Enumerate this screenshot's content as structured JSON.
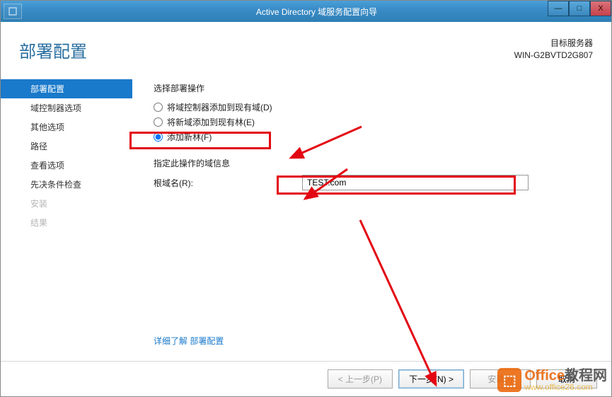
{
  "titlebar": {
    "title": "Active Directory 域服务配置向导",
    "min": "—",
    "max": "□",
    "close": "X"
  },
  "header": {
    "page_title": "部署配置",
    "target_label": "目标服务器",
    "target_value": "WIN-G2BVTD2G807"
  },
  "sidebar": {
    "items": [
      {
        "label": "部署配置",
        "state": "active"
      },
      {
        "label": "域控制器选项",
        "state": "normal"
      },
      {
        "label": "其他选项",
        "state": "normal"
      },
      {
        "label": "路径",
        "state": "normal"
      },
      {
        "label": "查看选项",
        "state": "normal"
      },
      {
        "label": "先决条件检查",
        "state": "normal"
      },
      {
        "label": "安装",
        "state": "disabled"
      },
      {
        "label": "结果",
        "state": "disabled"
      }
    ]
  },
  "panel": {
    "select_operation_label": "选择部署操作",
    "radios": [
      {
        "label": "将域控制器添加到现有域(D)",
        "checked": false
      },
      {
        "label": "将新域添加到现有林(E)",
        "checked": false
      },
      {
        "label": "添加新林(F)",
        "checked": true
      }
    ],
    "domain_info_label": "指定此操作的域信息",
    "root_domain_label": "根域名(R):",
    "root_domain_value": "TEST.com",
    "learn_more": "详细了解 部署配置"
  },
  "footer": {
    "prev": "< 上一步(P)",
    "next": "下一步(N) >",
    "install": "安装(I)",
    "cancel": "取消"
  },
  "watermark": {
    "brand1": "Office",
    "brand2": "教程网",
    "url": "www.office26.com"
  }
}
